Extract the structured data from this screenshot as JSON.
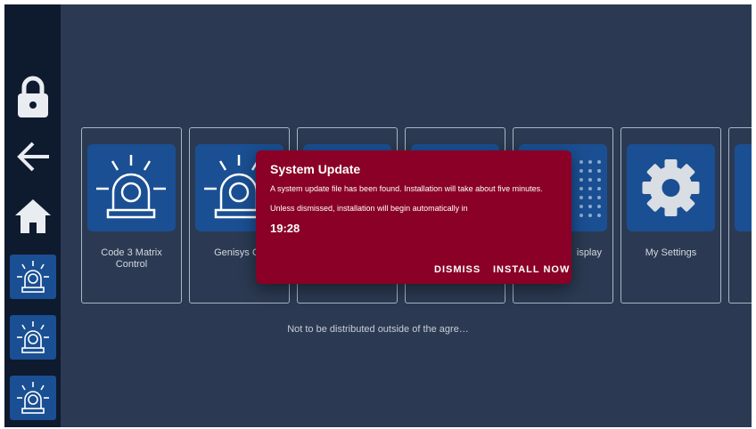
{
  "sidebar": {
    "items": [
      {
        "name": "lock",
        "icon": "lock-icon"
      },
      {
        "name": "back",
        "icon": "arrow-left-icon"
      },
      {
        "name": "home",
        "icon": "home-icon"
      },
      {
        "name": "app-1",
        "icon": "beacon-icon"
      },
      {
        "name": "app-2",
        "icon": "beacon-icon"
      },
      {
        "name": "app-3",
        "icon": "beacon-icon"
      }
    ]
  },
  "tiles": [
    {
      "label": "Code 3 Matrix Control",
      "icon": "beacon-icon"
    },
    {
      "label": "Genisys Co",
      "icon": "beacon-icon"
    },
    {
      "label": "",
      "icon": "app-icon"
    },
    {
      "label": "",
      "icon": "app-icon"
    },
    {
      "label": "isplay",
      "icon": "dot-grid-icon"
    },
    {
      "label": "My Settings",
      "icon": "gear-icon"
    },
    {
      "label": "",
      "icon": "app-icon"
    }
  ],
  "footer": {
    "text": "Not to be distributed outside of the agre…"
  },
  "dialog": {
    "title": "System Update",
    "message": "A system update file has been found. Installation will take about five minutes.",
    "message2": "Unless dismissed, installation will begin automatically in",
    "countdown": "19:28",
    "dismiss_label": "DISMISS",
    "install_label": "INSTALL NOW"
  },
  "colors": {
    "background": "#2b3a52",
    "sidebar": "#0e1a2e",
    "accent": "#1a4f93",
    "dialog": "#8a0026"
  }
}
